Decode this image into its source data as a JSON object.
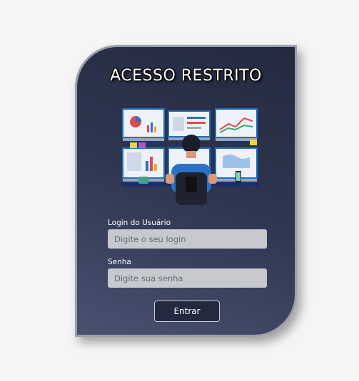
{
  "login_card": {
    "title": "ACESSO RESTRITO",
    "illustration": "analyst-at-monitors-illustration",
    "username_label": "Login do Usuário",
    "username_placeholder": "Digite o seu login",
    "username_value": "",
    "password_label": "Senha",
    "password_placeholder": "Digite sua senha",
    "password_value": "",
    "submit_label": "Entrar"
  },
  "colors": {
    "page_bg": "#f5f5f5",
    "card_bg_top": "#232a40",
    "card_bg_bottom": "#4a5170",
    "card_border": "#9aa0aa",
    "input_bg": "#c7c9ce",
    "button_bg": "#232a40"
  }
}
